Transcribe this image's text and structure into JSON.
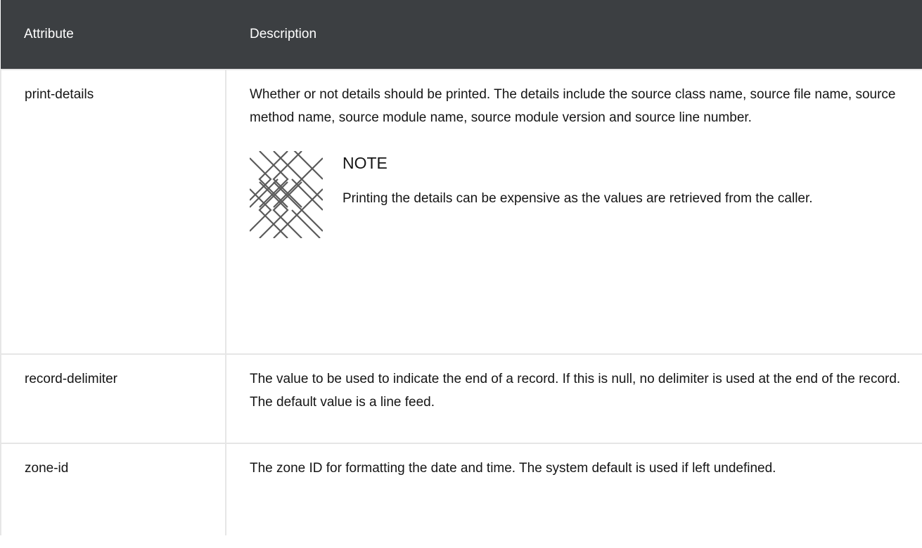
{
  "table": {
    "headers": [
      "Attribute",
      "Description"
    ],
    "rows": [
      {
        "attribute": "print-details",
        "description": "Whether or not details should be printed. The details include the source class name, source file name, source method name, source module name, source module version and source line number.",
        "note": {
          "title": "NOTE",
          "text": "Printing the details can be expensive as the values are retrieved from the caller.",
          "icon": "note-pattern-icon"
        }
      },
      {
        "attribute": "record-delimiter",
        "description": "The value to be used to indicate the end of a record. If this is null, no delimiter is used at the end of the record. The default value is a line feed."
      },
      {
        "attribute": "zone-id",
        "description": "The zone ID for formatting the date and time. The system default is used if left undefined."
      }
    ]
  },
  "colors": {
    "header_bg": "#3c3f42",
    "header_text": "#ffffff",
    "border": "#e6e6e6",
    "text": "#151515"
  }
}
